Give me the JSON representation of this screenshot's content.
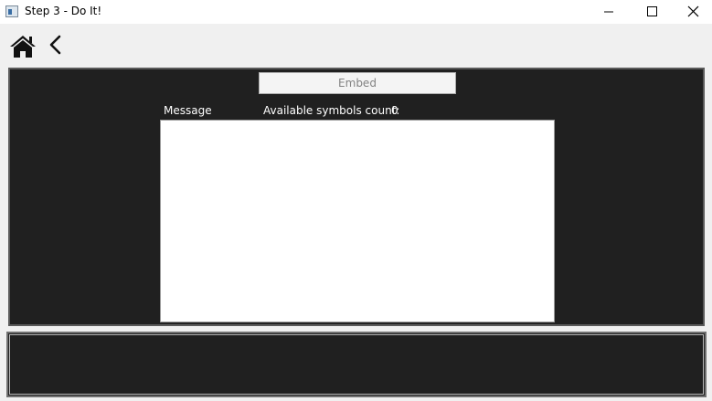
{
  "window": {
    "title": "Step 3 - Do It!",
    "app_icon": "window-app-icon",
    "minimize_icon": "minimize-icon",
    "maximize_icon": "maximize-icon",
    "close_icon": "close-icon"
  },
  "toolbar": {
    "home_icon": "home-icon",
    "back_icon": "chevron-left-icon"
  },
  "main": {
    "embed_label": "Embed",
    "message_label": "Message",
    "symbols_label": "Available symbols count:",
    "symbols_count": "0",
    "message_value": ""
  },
  "log": {
    "content": ""
  },
  "colors": {
    "panel_background": "#202020",
    "window_background": "#f0f0f0",
    "text_light": "#ffffff",
    "button_disabled_text": "#838383"
  }
}
